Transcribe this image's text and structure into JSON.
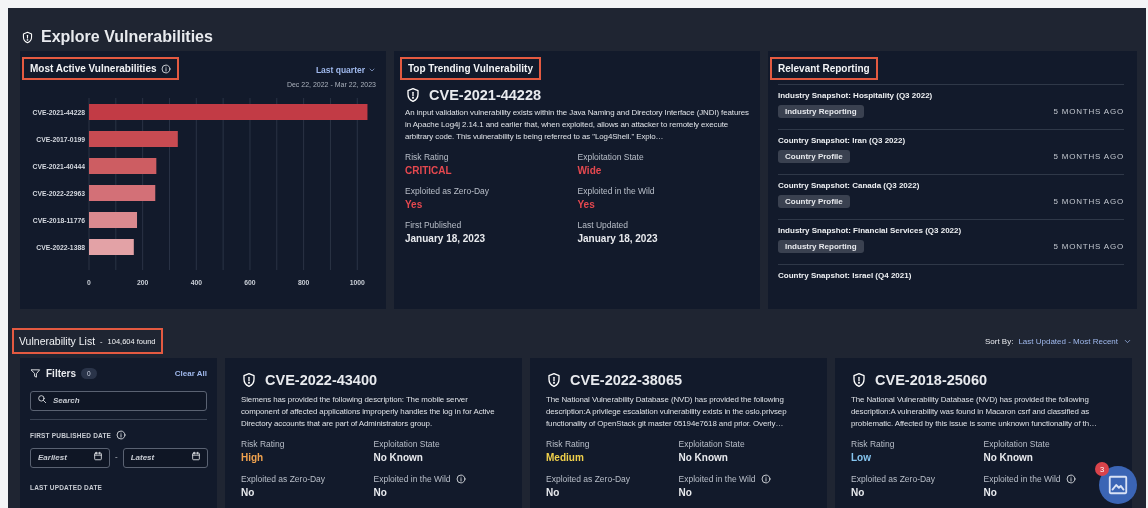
{
  "page": {
    "title": "Explore Vulnerabilities"
  },
  "most_active": {
    "title": "Most Active Vulnerabilities",
    "range_menu": "Last quarter",
    "date_range": "Dec 22, 2022 - Mar 22, 2023",
    "chart_data": {
      "type": "bar",
      "orientation": "horizontal",
      "categories": [
        "CVE-2021-44228",
        "CVE-2017-0199",
        "CVE-2021-40444",
        "CVE-2022-22963",
        "CVE-2018-11776",
        "CVE-2022-1388"
      ],
      "values": [
        1038,
        331,
        251,
        247,
        179,
        167
      ],
      "xlim": [
        0,
        1040
      ],
      "grid": true,
      "xticks": [
        0,
        200,
        400,
        600,
        800,
        1000
      ]
    }
  },
  "top_trending": {
    "title": "Top Trending Vulnerability",
    "cve": "CVE-2021-44228",
    "description": "An input validation vulnerability exists within the Java Naming and Directory Interface (JNDI) features in Apache Log4j 2.14.1 and earlier that, when exploited, allows an attacker to remotely execute arbitrary code. This vulnerability is being referred to as \"Log4Shell.\" Explo…",
    "fields": [
      {
        "label": "Risk Rating",
        "value": "CRITICAL",
        "color": "#e5484f",
        "info": false
      },
      {
        "label": "Exploitation State",
        "value": "Wide",
        "color": "#e5484f",
        "info": false
      },
      {
        "label": "Exploited as Zero-Day",
        "value": "Yes",
        "color": "#e5484f",
        "info": false
      },
      {
        "label": "Exploited in the Wild",
        "value": "Yes",
        "color": "#e5484f",
        "info": false
      },
      {
        "label": "First Published",
        "value": "January 18, 2023",
        "color": "#e8eaee",
        "info": false
      },
      {
        "label": "Last Updated",
        "value": "January 18, 2023",
        "color": "#e8eaee",
        "info": false
      }
    ]
  },
  "relevant_reporting": {
    "title": "Relevant Reporting",
    "items": [
      {
        "title": "Industry Snapshot: Hospitality (Q3 2022)",
        "tag": "Industry Reporting",
        "time": "5 MONTHS AGO"
      },
      {
        "title": "Country Snapshot: Iran (Q3 2022)",
        "tag": "Country Profile",
        "time": "5 MONTHS AGO"
      },
      {
        "title": "Country Snapshot: Canada (Q3 2022)",
        "tag": "Country Profile",
        "time": "5 MONTHS AGO"
      },
      {
        "title": "Industry Snapshot: Financial Services (Q3 2022)",
        "tag": "Industry Reporting",
        "time": "5 MONTHS AGO"
      },
      {
        "title": "Country Snapshot: Israel (Q4 2021)"
      }
    ]
  },
  "vulnerability_list": {
    "title": "Vulnerability List",
    "separator": "-",
    "count": "104,604 found",
    "sort_label": "Sort By:",
    "sort_value": "Last Updated - Most Recent"
  },
  "filters": {
    "title": "Filters",
    "count": "0",
    "clear": "Clear All",
    "search_placeholder": "Search",
    "sections": [
      {
        "label": "FIRST PUBLISHED DATE",
        "info": true,
        "from_placeholder": "Earliest",
        "separator": "-",
        "to_placeholder": "Latest"
      },
      {
        "label": "LAST UPDATED DATE",
        "info": false
      }
    ]
  },
  "cards": [
    {
      "cve": "CVE-2022-43400",
      "description": "Siemens has provided the following description: The mobile server component of affected applications improperly handles the log in for Active Directory accounts that are part of Administrators group.",
      "fields": [
        {
          "label": "Risk Rating",
          "value": "High",
          "color": "#f0a24e",
          "info": false
        },
        {
          "label": "Exploitation State",
          "value": "No Known",
          "color": "#e8eaee",
          "info": false
        },
        {
          "label": "Exploited as Zero-Day",
          "value": "No",
          "color": "#e8eaee",
          "info": false
        },
        {
          "label": "Exploited in the Wild",
          "value": "No",
          "color": "#e8eaee",
          "info": true
        }
      ]
    },
    {
      "cve": "CVE-2022-38065",
      "description": "The National Vulnerability Database (NVD) has provided the following description:A privilege escalation vulnerability exists in the oslo.privsep functionality of OpenStack git master 05194e7618 and prior. Overly…",
      "fields": [
        {
          "label": "Risk Rating",
          "value": "Medium",
          "color": "#f1d14b",
          "info": false
        },
        {
          "label": "Exploitation State",
          "value": "No Known",
          "color": "#e8eaee",
          "info": false
        },
        {
          "label": "Exploited as Zero-Day",
          "value": "No",
          "color": "#e8eaee",
          "info": false
        },
        {
          "label": "Exploited in the Wild",
          "value": "No",
          "color": "#e8eaee",
          "info": true
        }
      ]
    },
    {
      "cve": "CVE-2018-25060",
      "description": "The National Vulnerability Database (NVD) has provided the following description:A vulnerability was found in Macaron csrf and classified as problematic. Affected by this issue is some unknown functionality of th…",
      "fields": [
        {
          "label": "Risk Rating",
          "value": "Low",
          "color": "#86c5ef",
          "info": false
        },
        {
          "label": "Exploitation State",
          "value": "No Known",
          "color": "#e8eaee",
          "info": false
        },
        {
          "label": "Exploited as Zero-Day",
          "value": "No",
          "color": "#e8eaee",
          "info": false
        },
        {
          "label": "Exploited in the Wild",
          "value": "No",
          "color": "#e8eaee",
          "info": true
        }
      ]
    }
  ],
  "floating_button": {
    "badge": "3"
  }
}
